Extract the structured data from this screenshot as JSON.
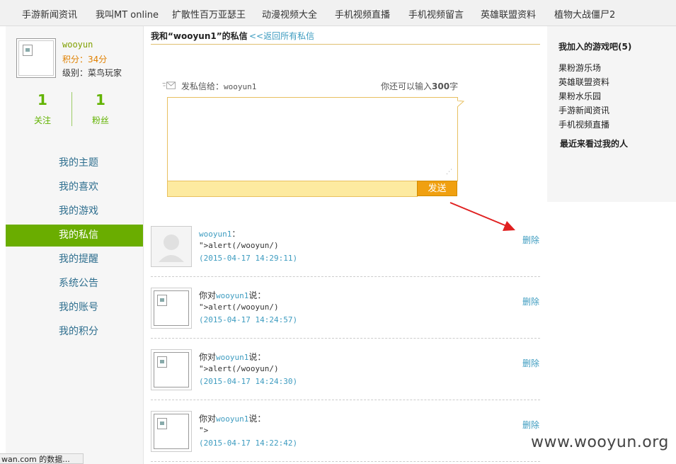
{
  "topnav": {
    "items": [
      "手游新闻资讯",
      "我叫MT online",
      "扩散性百万亚瑟王",
      "动漫视频大全",
      "手机视频直播",
      "手机视频留言",
      "英雄联盟资料",
      "植物大战僵尸2"
    ]
  },
  "profile": {
    "username": "wooyun",
    "points": "积分：34分",
    "level": "级别：菜鸟玩家",
    "follow_count": "1",
    "follow_label": "关注",
    "fans_count": "1",
    "fans_label": "粉丝"
  },
  "menu": {
    "items": [
      "我的主题",
      "我的喜欢",
      "我的游戏",
      "我的私信",
      "我的提醒",
      "系统公告",
      "我的账号",
      "我的积分"
    ],
    "active": "我的私信"
  },
  "conversation": {
    "title": "我和“wooyun1”的私信",
    "back_link": "<<返回所有私信"
  },
  "composer": {
    "label_prefix": "发私信给：",
    "recipient": "wooyun1",
    "char_left_prefix": "你还可以输入",
    "char_left_count": "300",
    "char_left_suffix": "字",
    "send_label": "发送"
  },
  "messages": [
    {
      "prefix": "",
      "user": "wooyun1",
      "suffix": "：",
      "body": "\">alert(/wooyun/)",
      "time": "(2015-04-17 14:29:11)",
      "delete": "删除",
      "avatar": "default-person"
    },
    {
      "prefix": "你对",
      "user": "wooyun1",
      "suffix": "说：",
      "body": "\">alert(/wooyun/)",
      "time": "(2015-04-17 14:24:57)",
      "delete": "删除",
      "avatar": "broken-image"
    },
    {
      "prefix": "你对",
      "user": "wooyun1",
      "suffix": "说：",
      "body": "\">alert(/wooyun/)",
      "time": "(2015-04-17 14:24:30)",
      "delete": "删除",
      "avatar": "broken-image"
    },
    {
      "prefix": "你对",
      "user": "wooyun1",
      "suffix": "说：",
      "body": "\">",
      "time": "(2015-04-17 14:22:42)",
      "delete": "删除",
      "avatar": "broken-image"
    }
  ],
  "rightbar": {
    "joined_title": "我加入的游戏吧(5)",
    "joined": [
      "果粉游乐场",
      "英雄联盟资料",
      "果粉水乐园",
      "手游新闻资讯",
      "手机视频直播"
    ],
    "visitors_title": "最近来看过我的人"
  },
  "status_bar": "wan.com 的数据...",
  "watermark": "www.wooyun.org",
  "colors": {
    "accent_green": "#6aad00",
    "link_blue": "#3e9cc0",
    "send_orange": "#f0a010",
    "annotation_red": "#e02020"
  }
}
